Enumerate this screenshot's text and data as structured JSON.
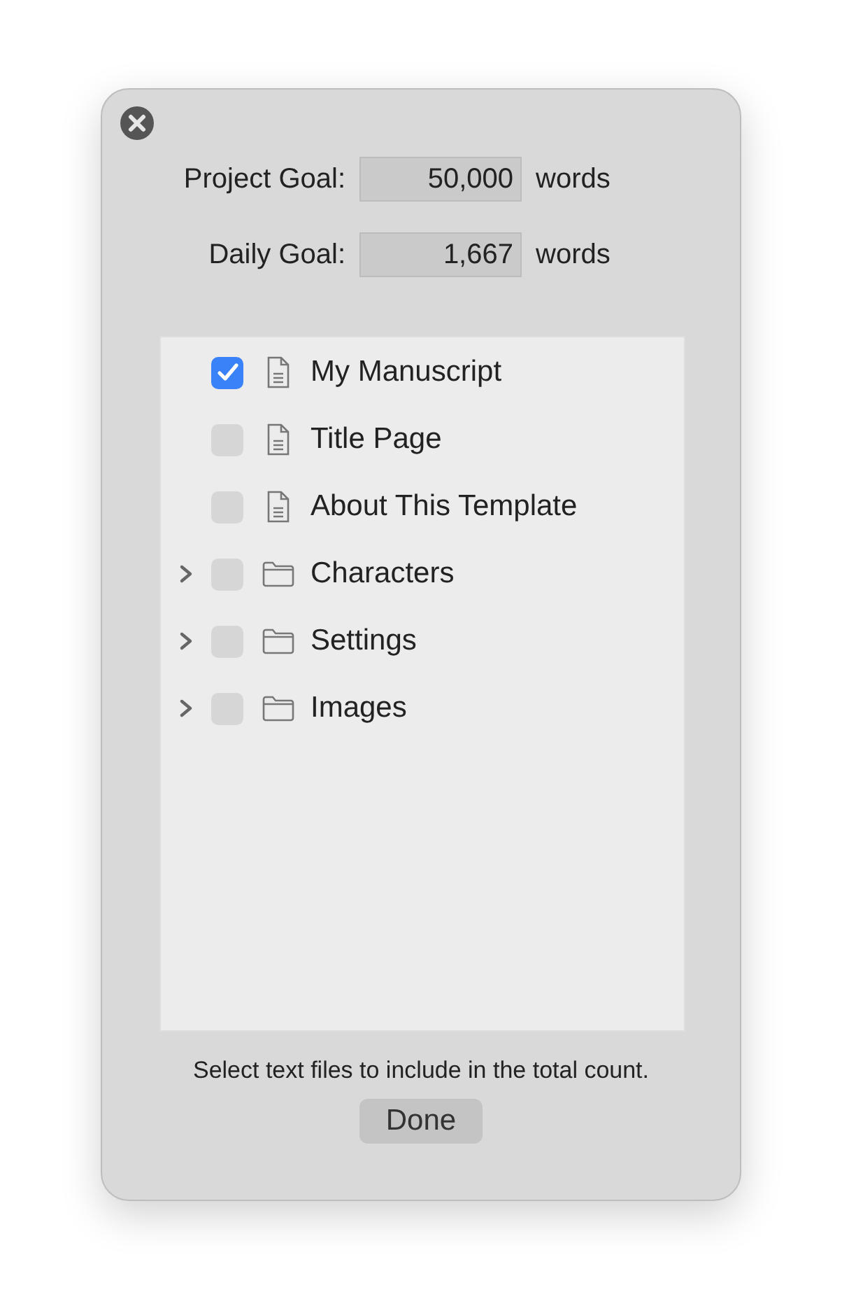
{
  "goals": [
    {
      "label": "Project Goal:",
      "value": "50,000",
      "unit": "words"
    },
    {
      "label": "Daily Goal:",
      "value": "1,667",
      "unit": "words"
    }
  ],
  "items": [
    {
      "kind": "document",
      "name": "My Manuscript",
      "checked": true
    },
    {
      "kind": "document",
      "name": "Title Page",
      "checked": false
    },
    {
      "kind": "document",
      "name": "About This Template",
      "checked": false
    },
    {
      "kind": "folder",
      "name": "Characters",
      "checked": false,
      "expanded": false
    },
    {
      "kind": "folder",
      "name": "Settings",
      "checked": false,
      "expanded": false
    },
    {
      "kind": "folder",
      "name": "Images",
      "checked": false,
      "expanded": false
    }
  ],
  "hint": "Select text files to include in the total count.",
  "buttons": [
    "Done"
  ]
}
